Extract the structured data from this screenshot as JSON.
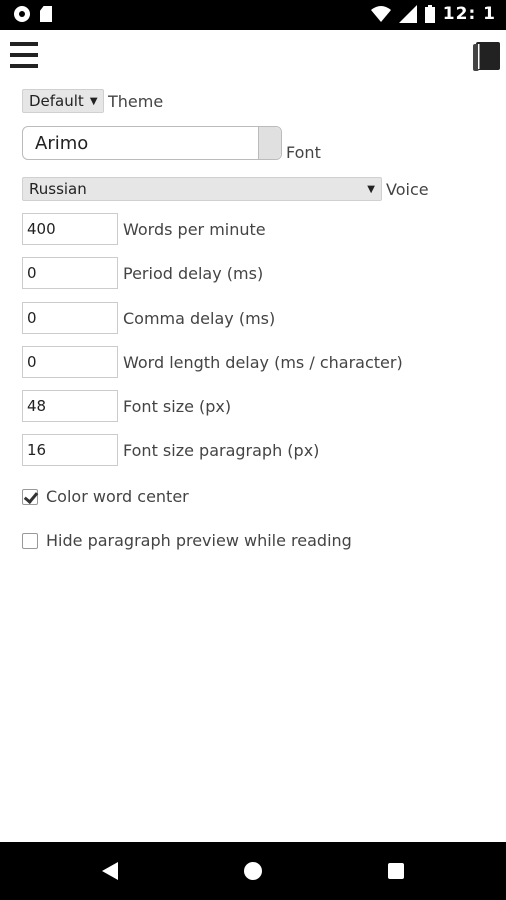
{
  "status_bar": {
    "time": "12: 1"
  },
  "toolbar": {
    "menu_icon": "hamburger-menu-icon",
    "book_icon": "book-icon"
  },
  "theme": {
    "value": "Default",
    "label": "Theme"
  },
  "font": {
    "value": "Arimo",
    "label": "Font"
  },
  "voice": {
    "value": "Russian",
    "label": "Voice"
  },
  "fields": [
    {
      "value": "400",
      "label": "Words per minute"
    },
    {
      "value": "0",
      "label": "Period delay (ms)"
    },
    {
      "value": "0",
      "label": "Comma delay (ms)"
    },
    {
      "value": "0",
      "label": "Word length delay (ms / character)"
    },
    {
      "value": "48",
      "label": "Font size (px)"
    },
    {
      "value": "16",
      "label": "Font size paragraph (px)"
    }
  ],
  "checkboxes": [
    {
      "label": "Color word center",
      "checked": true
    },
    {
      "label": "Hide paragraph preview while reading",
      "checked": false
    }
  ]
}
